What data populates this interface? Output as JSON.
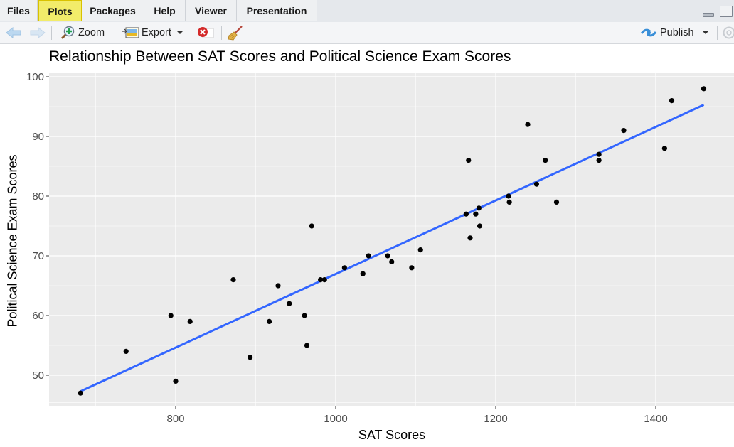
{
  "tabs": [
    {
      "label": "Files",
      "active": false
    },
    {
      "label": "Plots",
      "active": true
    },
    {
      "label": "Packages",
      "active": false
    },
    {
      "label": "Help",
      "active": false
    },
    {
      "label": "Viewer",
      "active": false
    },
    {
      "label": "Presentation",
      "active": false
    }
  ],
  "toolbar": {
    "back_icon": "arrow-left-icon",
    "forward_icon": "arrow-right-icon",
    "zoom_label": "Zoom",
    "export_label": "Export",
    "remove_icon": "remove-plot-icon",
    "clear_icon": "broom-icon",
    "publish_label": "Publish",
    "refresh_icon": "refresh-icon"
  },
  "colors": {
    "panel_bg": "#ebebeb",
    "grid": "#ffffff",
    "point": "#000000",
    "fit_line": "#3366ff",
    "active_tab": "#f2ec6a"
  },
  "chart_data": {
    "type": "scatter",
    "title": "Relationship Between SAT Scores and Political Science Exam Scores",
    "xlabel": "SAT Scores",
    "ylabel": "Political Science Exam Scores",
    "xlim": [
      650,
      1480
    ],
    "ylim": [
      45,
      100.5
    ],
    "xticks": [
      800,
      1000,
      1200,
      1400
    ],
    "yticks": [
      50,
      60,
      70,
      80,
      90,
      100
    ],
    "x_minor": [
      700,
      900,
      1100,
      1300
    ],
    "y_minor": [
      55,
      65,
      75,
      85,
      95
    ],
    "grid": true,
    "points": [
      [
        681,
        47
      ],
      [
        738,
        54
      ],
      [
        794,
        60
      ],
      [
        800,
        49
      ],
      [
        818,
        59
      ],
      [
        872,
        66
      ],
      [
        893,
        53
      ],
      [
        917,
        59
      ],
      [
        928,
        65
      ],
      [
        942,
        62
      ],
      [
        961,
        60
      ],
      [
        964,
        55
      ],
      [
        970,
        75
      ],
      [
        981,
        66
      ],
      [
        986,
        66
      ],
      [
        1011,
        68
      ],
      [
        1034,
        67
      ],
      [
        1041,
        70
      ],
      [
        1065,
        70
      ],
      [
        1070,
        69
      ],
      [
        1095,
        68
      ],
      [
        1106,
        71
      ],
      [
        1163,
        77
      ],
      [
        1166,
        86
      ],
      [
        1168,
        73
      ],
      [
        1175,
        77
      ],
      [
        1179,
        78
      ],
      [
        1180,
        75
      ],
      [
        1216,
        80
      ],
      [
        1217,
        79
      ],
      [
        1240,
        92
      ],
      [
        1251,
        82
      ],
      [
        1262,
        86
      ],
      [
        1276,
        79
      ],
      [
        1329,
        87
      ],
      [
        1329,
        86
      ],
      [
        1360,
        91
      ],
      [
        1411,
        88
      ],
      [
        1420,
        96
      ],
      [
        1460,
        98
      ]
    ],
    "fit_line": {
      "x": [
        681,
        1460
      ],
      "y": [
        47.3,
        95.3
      ]
    }
  }
}
